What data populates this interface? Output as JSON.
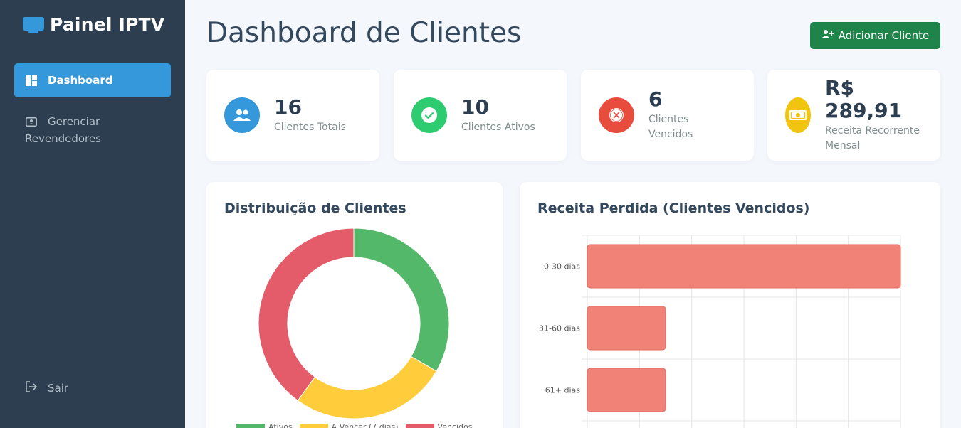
{
  "sidebar": {
    "brand": "Painel IPTV",
    "items": [
      {
        "label": "Dashboard",
        "icon": "dashboard-icon",
        "active": true
      },
      {
        "label": "Gerenciar Revendedores",
        "icon": "id-card-icon",
        "active": false
      }
    ],
    "logout_label": "Sair"
  },
  "header": {
    "title": "Dashboard de Clientes",
    "add_button_label": "Adicionar Cliente"
  },
  "stats": [
    {
      "value": "16",
      "label": "Clientes Totais",
      "icon": "users-icon",
      "color": "#3498db"
    },
    {
      "value": "10",
      "label": "Clientes Ativos",
      "icon": "check-circle-icon",
      "color": "#2ecc71"
    },
    {
      "value": "6",
      "label": "Clientes Vencidos",
      "icon": "x-circle-icon",
      "color": "#e74c3c"
    },
    {
      "value": "R$ 289,91",
      "label": "Receita Recorrente Mensal",
      "icon": "money-bill-icon",
      "color": "#f1c40f"
    }
  ],
  "colors": {
    "sidebar_bg": "#2c3e50",
    "accent": "#3498db",
    "button_green": "#1e8449",
    "active": "#54b86a",
    "expiring": "#ffcd3c",
    "expired": "#e45c6a",
    "bar": "#f08277"
  },
  "chart_data": [
    {
      "type": "pie",
      "title": "Distribuição de Clientes",
      "categories": [
        "Ativos",
        "A Vencer (7 dias)",
        "Vencidos"
      ],
      "values": [
        5,
        4,
        6
      ],
      "legend": "bottom"
    },
    {
      "type": "bar",
      "orientation": "horizontal",
      "title": "Receita Perdida (Clientes Vencidos)",
      "categories": [
        "0-30 dias",
        "31-60 dias",
        "61+ dias"
      ],
      "values": [
        60,
        15,
        15
      ],
      "xlim": [
        0,
        60
      ],
      "grid": true
    }
  ]
}
